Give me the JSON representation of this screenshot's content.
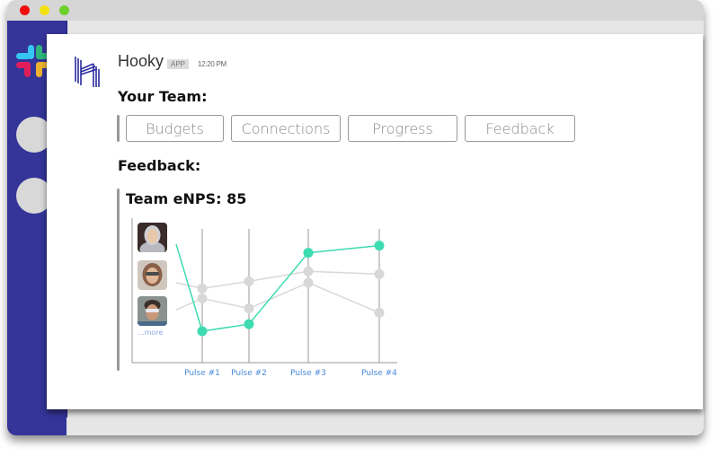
{
  "window": {
    "traffic_lights": [
      "close",
      "minimize",
      "maximize"
    ]
  },
  "sidebar": {
    "logo": "slack-logo",
    "workspaces": [
      "workspace-1",
      "workspace-2"
    ]
  },
  "message": {
    "app_name": "Hooky",
    "badge": "APP",
    "timestamp": "12:20 PM",
    "heading_team": "Your Team:",
    "buttons": [
      "Budgets",
      "Connections",
      "Progress",
      "Feedback"
    ],
    "heading_feedback": "Feedback:",
    "more_link": "...more"
  },
  "colors": {
    "sidebar": "#343499",
    "accent_green": "#3ddbb0",
    "gray_line": "#d8d8d8",
    "link_blue": "#4a8ad8"
  },
  "chart_data": {
    "type": "line",
    "title": "Team eNPS: 85",
    "categories": [
      "Pulse #1",
      "Pulse #2",
      "Pulse #3",
      "Pulse #4"
    ],
    "ylim": [
      0,
      100
    ],
    "grid": "vertical",
    "series": [
      {
        "name": "person-1",
        "start": 83,
        "values": [
          22,
          27,
          77,
          82
        ],
        "color": "#3ddbb0",
        "highlight": true
      },
      {
        "name": "person-2",
        "start": 56,
        "values": [
          52,
          57,
          64,
          62
        ],
        "color": "#d8d8d8",
        "highlight": false
      },
      {
        "name": "person-3",
        "start": 37,
        "values": [
          45,
          38,
          56,
          35
        ],
        "color": "#d8d8d8",
        "highlight": false
      }
    ]
  }
}
